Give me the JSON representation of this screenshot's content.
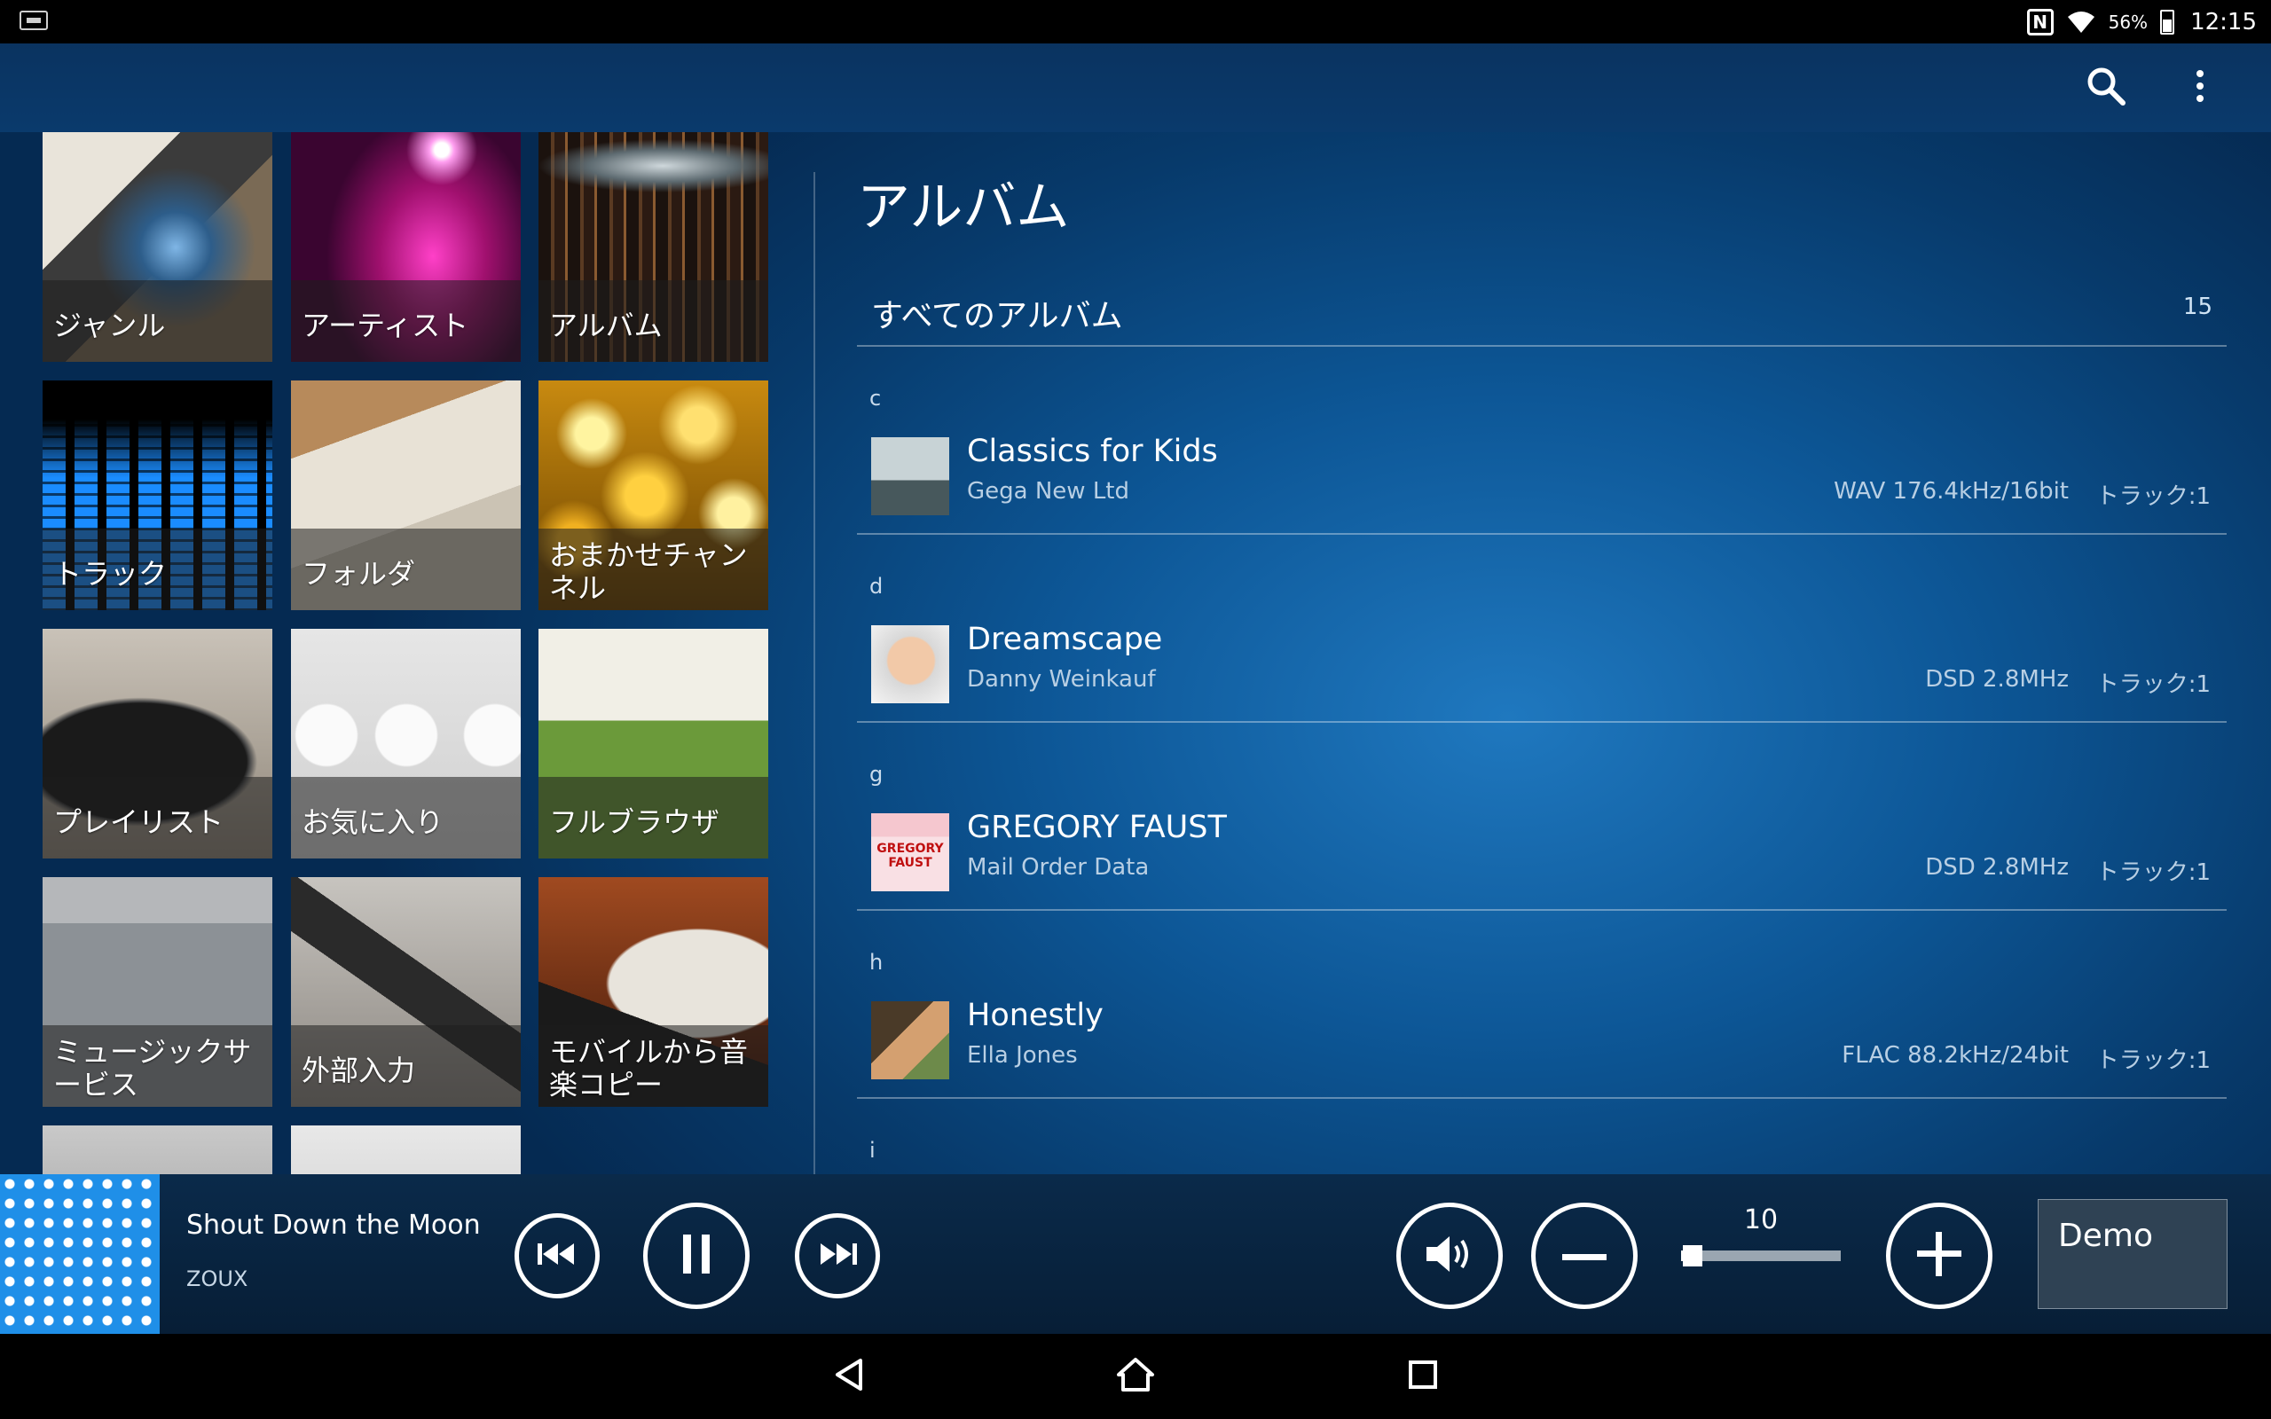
{
  "status_bar": {
    "battery_percent": "56%",
    "clock": "12:15",
    "icons": [
      "notification-icon",
      "nfc-icon",
      "wifi-icon",
      "battery-icon"
    ],
    "nfc_letter": "N"
  },
  "action_bar": {
    "icons": [
      "search-icon",
      "overflow-menu-icon"
    ]
  },
  "tiles": [
    {
      "label": "ジャンル"
    },
    {
      "label": "アーティスト"
    },
    {
      "label": "アルバム"
    },
    {
      "label": "トラック"
    },
    {
      "label": "フォルダ"
    },
    {
      "label": "おまかせチャンネル"
    },
    {
      "label": "プレイリスト"
    },
    {
      "label": "お気に入り"
    },
    {
      "label": "フルブラウザ"
    },
    {
      "label": "ミュージックサービス"
    },
    {
      "label": "外部入力"
    },
    {
      "label": "モバイルから音楽コピー"
    }
  ],
  "album_panel": {
    "title": "アルバム",
    "all_albums_label": "すべてのアルバム",
    "all_albums_count": "15",
    "sections": [
      {
        "letter": "c",
        "album": {
          "name": "Classics for Kids",
          "artist": "Gega New Ltd",
          "format": "WAV 176.4kHz/16bit",
          "tracks": "トラック:1"
        }
      },
      {
        "letter": "d",
        "album": {
          "name": "Dreamscape",
          "artist": "Danny Weinkauf",
          "format": "DSD 2.8MHz",
          "tracks": "トラック:1"
        }
      },
      {
        "letter": "g",
        "album": {
          "name": "GREGORY FAUST",
          "artist": "Mail Order Data",
          "format": "DSD 2.8MHz",
          "tracks": "トラック:1",
          "cover_text": "GREGORY FAUST"
        }
      },
      {
        "letter": "h",
        "album": {
          "name": "Honestly",
          "artist": "Ella Jones",
          "format": "FLAC 88.2kHz/24bit",
          "tracks": "トラック:1"
        }
      }
    ],
    "next_letter": "i"
  },
  "player": {
    "title": "Shout Down the Moon",
    "artist": "ZOUX",
    "volume": "10",
    "volume_fraction": 0.07,
    "demo_label": "Demo",
    "icons": [
      "previous-icon",
      "pause-icon",
      "next-icon",
      "speaker-icon",
      "minus-icon",
      "plus-icon"
    ]
  },
  "nav_bar": {
    "icons": [
      "back-icon",
      "home-icon",
      "recent-apps-icon"
    ]
  },
  "colors": {
    "background_blue": "#0d5797",
    "player_bar": "#0a2a4a",
    "divider": "#ffffff"
  }
}
